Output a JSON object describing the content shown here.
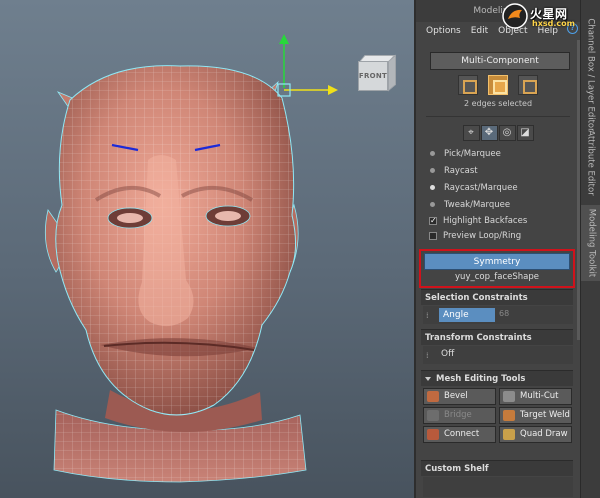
{
  "viewport": {
    "viewcube_label": "FRONT"
  },
  "panel": {
    "title": "Modeling T",
    "menu": [
      "Options",
      "Edit",
      "Object",
      "Help"
    ],
    "multi_component_label": "Multi-Component",
    "selection_status": "2 edges selected",
    "pick_modes": [
      "Pick/Marquee",
      "Raycast",
      "Raycast/Marquee",
      "Tweak/Marquee"
    ],
    "selected_pick_mode": "Raycast/Marquee",
    "highlight_backfaces": "Highlight Backfaces",
    "preview_loop_ring": "Preview Loop/Ring",
    "symmetry_button": "Symmetry",
    "symmetry_target": "yuy_cop_faceShape",
    "selection_constraints": {
      "header": "Selection Constraints",
      "field": "Angle",
      "value": "68"
    },
    "transform_constraints": {
      "header": "Transform Constraints",
      "value": "Off"
    },
    "mesh_editing_tools": {
      "header": "Mesh Editing Tools",
      "buttons": [
        "Bevel",
        "Multi-Cut",
        "Bridge",
        "Target Weld",
        "Connect",
        "Quad Draw"
      ]
    },
    "custom_shelf": "Custom Shelf"
  },
  "tabs": [
    "Channel Box / Layer Editor",
    "Attribute Editor",
    "Modeling Toolkit"
  ],
  "watermark": {
    "text": "火星网",
    "url": "hxsd.com"
  },
  "colors": {
    "accent_blue": "#5b8ec0",
    "highlight_red": "#d0121b",
    "mesh_skin": "#d0877a",
    "wire": "#8fe8f5"
  }
}
